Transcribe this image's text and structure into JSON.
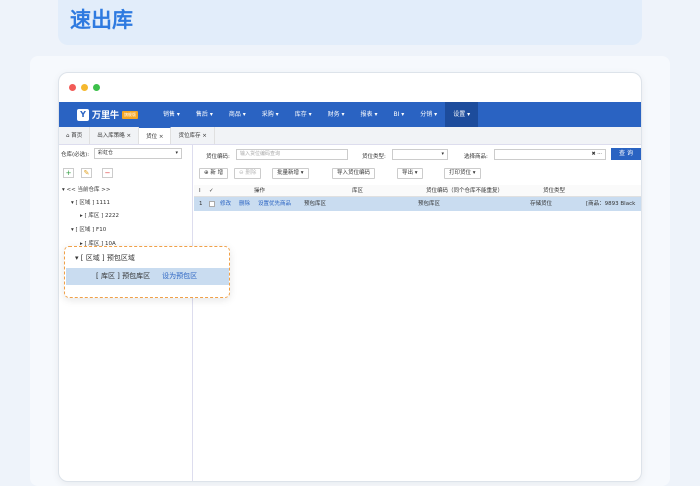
{
  "page_title": "速出库",
  "window": {
    "dot_colors": [
      "#f25b57",
      "#f5b82e",
      "#3cc04a"
    ]
  },
  "nav": {
    "brand": "万里牛",
    "badge": "旗舰版",
    "items": [
      "销售 ▾",
      "售后 ▾",
      "商品 ▾",
      "采购 ▾",
      "库存 ▾",
      "财务 ▾",
      "报表 ▾",
      "BI ▾",
      "分销 ▾",
      "设置 ▾"
    ]
  },
  "tabs": [
    {
      "label": "⌂ 首页"
    },
    {
      "label": "出入库策略 ×"
    },
    {
      "label": "货位 ×"
    },
    {
      "label": "货位库存 ×"
    }
  ],
  "left": {
    "warehouse_label": "仓库(必选):",
    "warehouse_value": "彩虹仓",
    "add": "+",
    "edit": "✎",
    "remove": "−",
    "tree": [
      "▾ << 当前仓库 >>",
      "▾ [ 区域 ] 1111",
      "▸ [ 库区 ] 2222",
      "▾ [ 区域 ] F10",
      "▸ [ 库区 ] 10A"
    ]
  },
  "filters": {
    "code_label": "货位编码:",
    "code_placeholder": "输入货位编码查询",
    "type_label": "货位类型:",
    "goods_label": "选择商品:",
    "clear": "✖ ···",
    "query": "查 询"
  },
  "toolbar": {
    "add": "⊕ 新 增",
    "delete": "⊖ 删除",
    "batch_add": "批量新增 ▾",
    "import": "导入货位编码",
    "export": "导出 ▾",
    "print": "打印货位 ▾"
  },
  "table": {
    "headers": [
      "Ⅰ",
      "✓",
      "操作",
      "库区",
      "货位编码（同个仓库不能重复）",
      "货位类型"
    ],
    "rows": [
      {
        "index": "1",
        "actions": [
          "修改",
          "删除",
          "设置优先商品"
        ],
        "area_name": "预包库区",
        "area": "预包库区",
        "type": "存储货位",
        "goods": "[商品：9893 Black"
      }
    ]
  },
  "popup": {
    "region": "▾ [ 区域 ] 预包区域",
    "zone": "[ 库区 ] 预包库区",
    "set_action": "设为预包区"
  }
}
